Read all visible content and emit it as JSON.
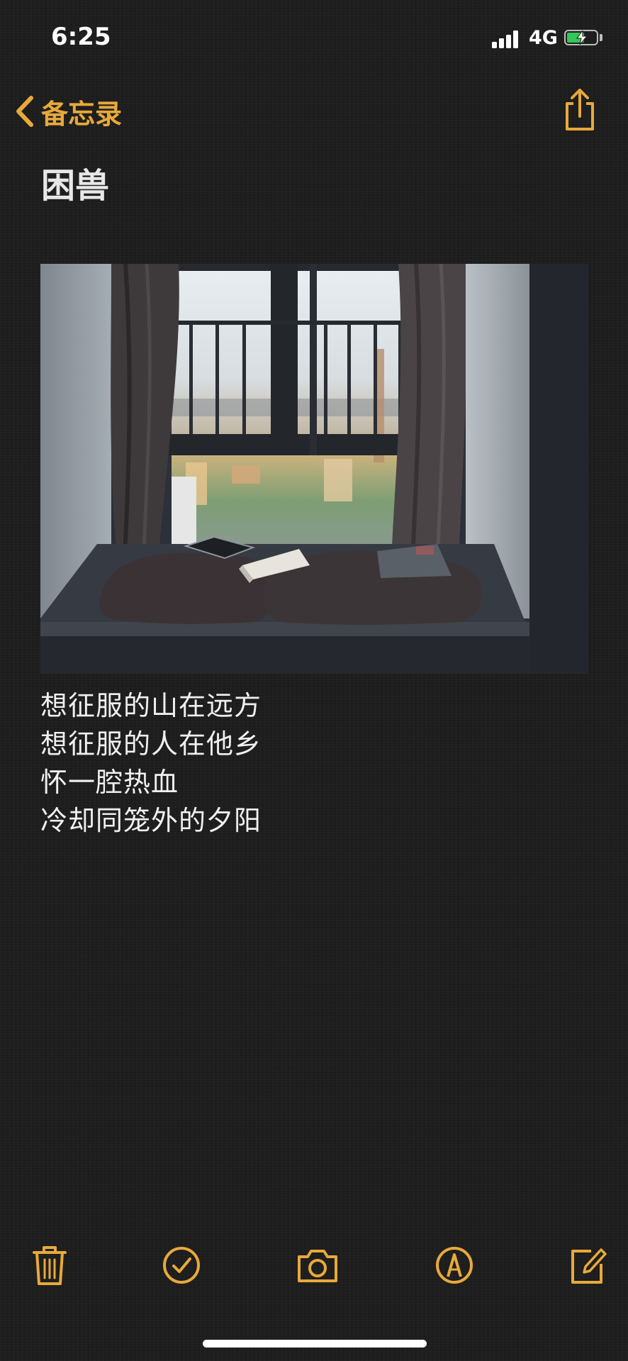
{
  "status_bar": {
    "time": "6:25",
    "network": "4G",
    "battery_level": 0.6
  },
  "nav": {
    "back_label": "备忘录",
    "back_icon": "chevron-left-icon",
    "share_icon": "share-icon"
  },
  "note": {
    "title": "困兽",
    "lines": [
      "想征服的山在远方",
      "想征服的人在他乡",
      "怀一腔热血",
      "冷却同笼外的夕阳"
    ]
  },
  "toolbar": {
    "items": [
      "trash-icon",
      "checklist-icon",
      "camera-icon",
      "markup-pen-icon",
      "compose-icon"
    ]
  },
  "colors": {
    "accent": "#e8a93a",
    "background": "#1c1c1c",
    "text": "#f0f0f0"
  }
}
